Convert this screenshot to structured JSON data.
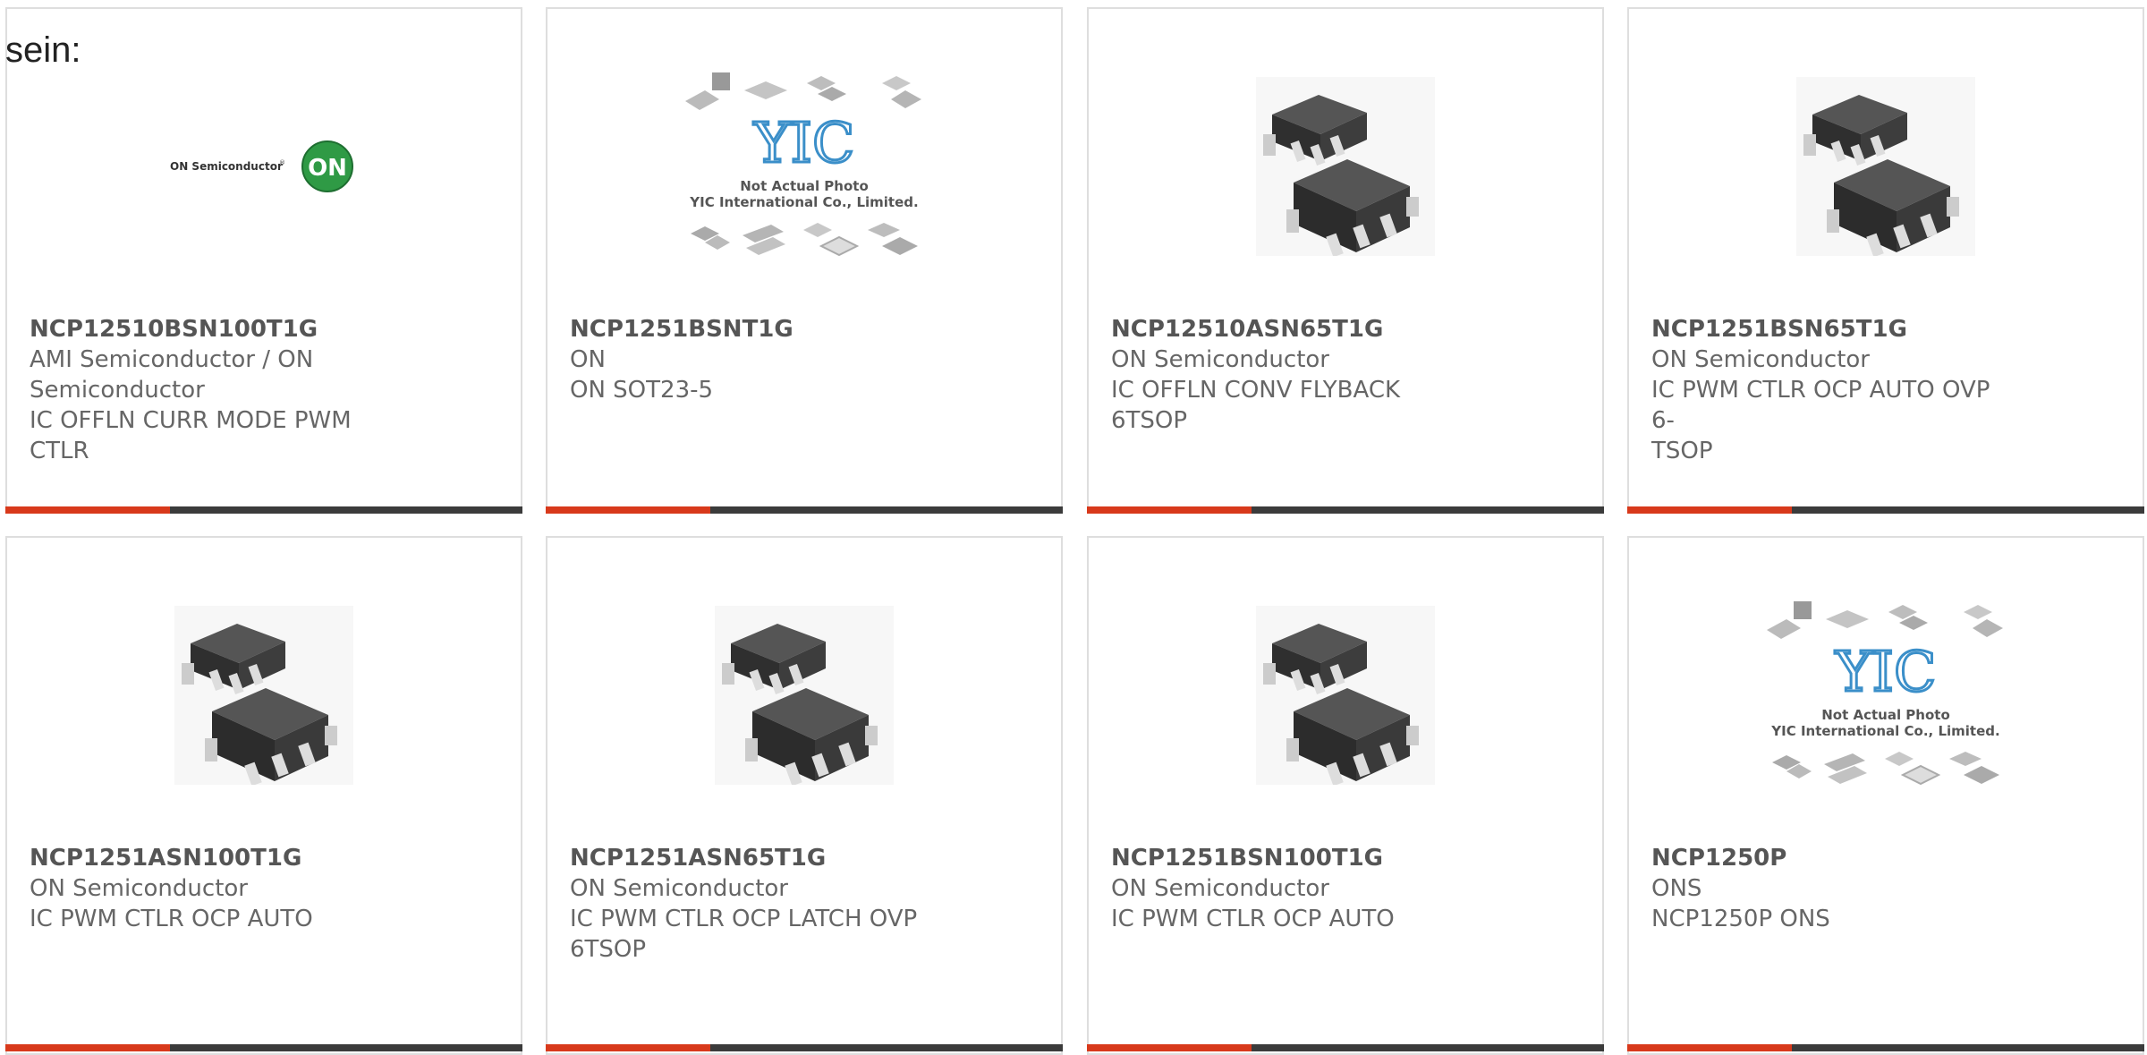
{
  "intro_text": "sein:",
  "colors": {
    "accent": "#d8391b",
    "bar": "#3b3b3b",
    "border": "#dedede",
    "text": "#555555"
  },
  "logo": {
    "brand_text": "ON Semiconductor",
    "badge_text": "ON"
  },
  "yic_placeholder": {
    "logo_text": "YIC",
    "caption_line1": "Not Actual Photo",
    "caption_line2": "YIC International Co., Limited."
  },
  "products": [
    {
      "part": "NCP12510BSN100T1G",
      "lines": [
        "AMI Semiconductor / ON",
        "Semiconductor",
        "IC OFFLN CURR MODE PWM",
        "CTLR"
      ],
      "image": "on-semi-logo"
    },
    {
      "part": "NCP1251BSNT1G",
      "lines": [
        "ON",
        "ON SOT23-5",
        "",
        ""
      ],
      "image": "yic-not-actual-photo"
    },
    {
      "part": "NCP12510ASN65T1G",
      "lines": [
        "ON Semiconductor",
        "IC OFFLN CONV FLYBACK 6TSOP",
        "",
        ""
      ],
      "image": "tsop6-chip"
    },
    {
      "part": "NCP1251BSN65T1G",
      "lines": [
        "ON Semiconductor",
        "IC PWM CTLR OCP AUTO OVP 6-",
        "TSOP",
        ""
      ],
      "image": "tsop6-chip"
    },
    {
      "part": "NCP1251ASN100T1G",
      "lines": [
        "ON Semiconductor",
        "IC PWM CTLR OCP AUTO",
        "",
        ""
      ],
      "image": "tsop6-chip"
    },
    {
      "part": "NCP1251ASN65T1G",
      "lines": [
        "ON Semiconductor",
        "IC PWM CTLR OCP LATCH OVP",
        "6TSOP",
        ""
      ],
      "image": "tsop6-chip"
    },
    {
      "part": "NCP1251BSN100T1G",
      "lines": [
        "ON Semiconductor",
        "IC PWM CTLR OCP AUTO",
        "",
        ""
      ],
      "image": "tsop6-chip"
    },
    {
      "part": "NCP1250P",
      "lines": [
        "ONS",
        "NCP1250P ONS",
        "",
        ""
      ],
      "image": "yic-not-actual-photo"
    }
  ]
}
